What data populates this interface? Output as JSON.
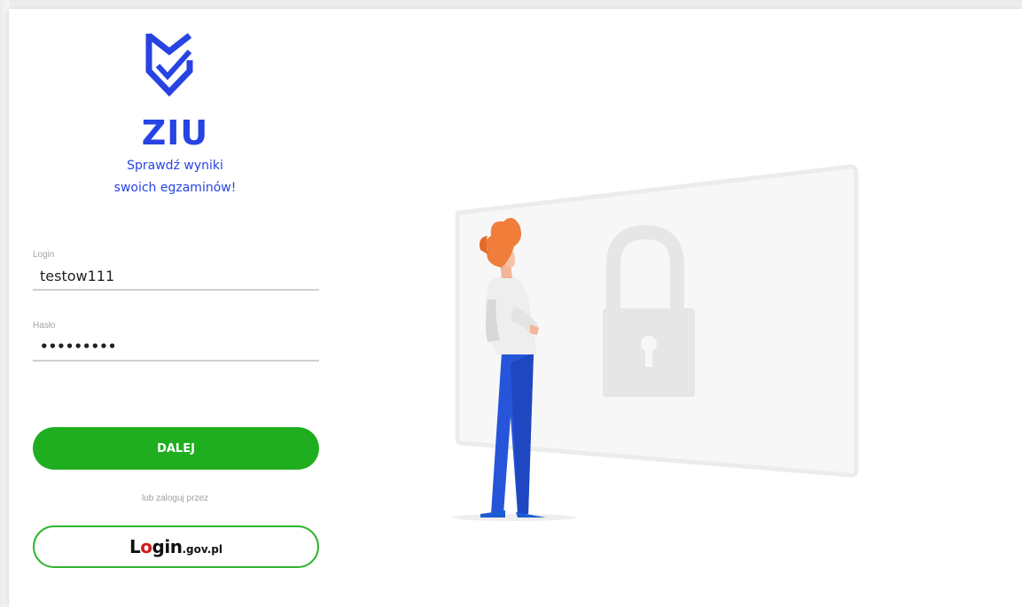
{
  "brand": {
    "name": "ZIU",
    "tagline_line1": "Sprawdź wyniki",
    "tagline_line2": "swoich egzaminów!"
  },
  "form": {
    "login_label": "Login",
    "login_value": "testow111",
    "password_label": "Hasło",
    "password_value": "•••••••••"
  },
  "actions": {
    "submit_label": "DALEJ",
    "alt_login_text": "lub zaloguj przez",
    "gov_login_main": "Login",
    "gov_login_suffix": ".gov.pl"
  },
  "colors": {
    "brand_blue": "#2743e3",
    "primary_green": "#1fae1f",
    "gov_red": "#d11a1a"
  },
  "icons": {
    "logo": "shield-check-icon",
    "illustration": "padlock-illustration"
  }
}
